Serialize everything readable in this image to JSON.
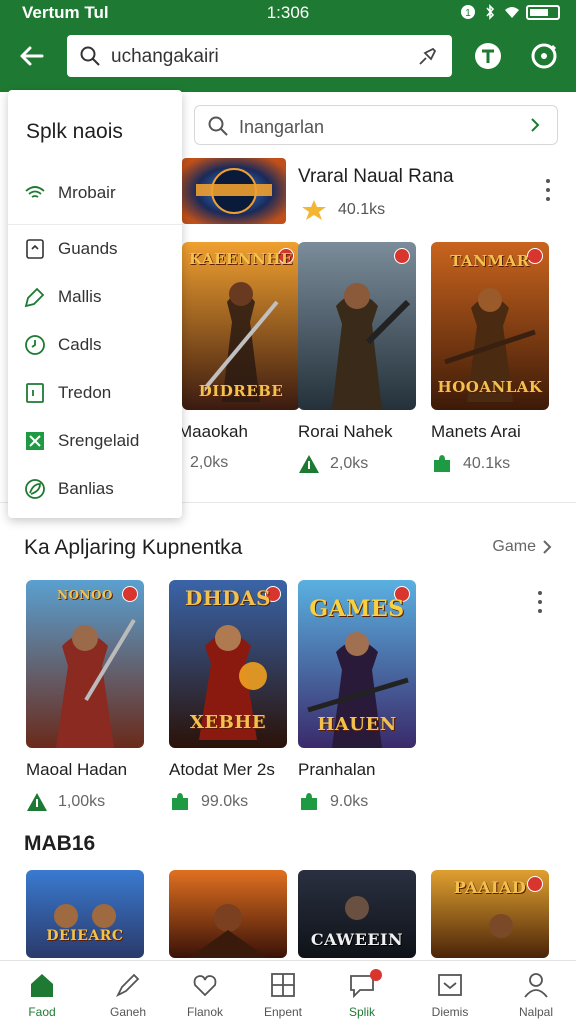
{
  "status_bar": {
    "carrier": "Vertum Tul",
    "time": "1:306"
  },
  "search_bar": {
    "query": "uchangakairi"
  },
  "secondary_search": {
    "placeholder": "Inangarlan"
  },
  "featured": {
    "title": "Vraral Naual Rana",
    "rating": "40.1ks"
  },
  "top_row": [
    {
      "title": "Maaokah",
      "meta": "2,0ks",
      "art_text": "KAEENNHE",
      "art_bottom": "DIDREBE",
      "colors": [
        "#f0a030",
        "#3a1a10"
      ]
    },
    {
      "title": "Rorai Nahek",
      "meta": "2,0ks",
      "art_text": "",
      "art_bottom": "",
      "colors": [
        "#7b8c9a",
        "#24313a"
      ]
    },
    {
      "title": "Manets Arai",
      "meta": "40.1ks",
      "art_text": "TANMAR",
      "art_bottom": "HOOANLAK",
      "colors": [
        "#c9641e",
        "#3c1a08"
      ]
    }
  ],
  "section_1": {
    "title": "Ka Apljaring Kupnentka",
    "link": "Game",
    "cards": [
      {
        "title": "Maoal Hadan",
        "meta": "1,00ks",
        "art_text": "NONOO",
        "art_bottom": "",
        "colors": [
          "#5aa0d0",
          "#6a2a1a"
        ]
      },
      {
        "title": "Atodat Mer 2s",
        "meta": "99.0ks",
        "art_text": "DHDAS",
        "art_bottom": "XEBHE",
        "colors": [
          "#3a64a8",
          "#2a1208"
        ]
      },
      {
        "title": "Pranhalan",
        "meta": "9.0ks",
        "art_text": "GAMES",
        "art_bottom": "HAUEN",
        "colors": [
          "#5ab0e0",
          "#3a2a6a"
        ]
      }
    ]
  },
  "section_2": {
    "title": "MAB16",
    "cards": [
      {
        "art_text": "",
        "art_bottom": "DEIEARC",
        "colors": [
          "#3a7ad0",
          "#2a3a6a"
        ]
      },
      {
        "art_text": "",
        "art_bottom": "",
        "colors": [
          "#e07020",
          "#3a1208"
        ]
      },
      {
        "art_text": "",
        "art_bottom": "CAWEEIN",
        "colors": [
          "#2a3040",
          "#0e1218"
        ]
      },
      {
        "art_text": "PAAIAD",
        "art_bottom": "",
        "colors": [
          "#e0a030",
          "#4a2408"
        ]
      }
    ]
  },
  "menu": {
    "title": "Splk naois",
    "items": [
      {
        "label": "Mrobair",
        "icon": "wifi-icon"
      },
      {
        "label": "Guands",
        "icon": "tablet-icon"
      },
      {
        "label": "Mallis",
        "icon": "tag-icon"
      },
      {
        "label": "Cadls",
        "icon": "clock-icon"
      },
      {
        "label": "Tredon",
        "icon": "book-icon"
      },
      {
        "label": "Srengelaid",
        "icon": "grid-icon"
      },
      {
        "label": "Banlias",
        "icon": "leaf-icon"
      }
    ]
  },
  "bottom_nav": [
    {
      "label": "Faod",
      "icon": "home-icon",
      "active": true
    },
    {
      "label": "Ganeh",
      "icon": "pen-icon",
      "active": false
    },
    {
      "label": "Flanok",
      "icon": "heart-icon",
      "active": false
    },
    {
      "label": "Enpent",
      "icon": "grid-icon",
      "active": false
    },
    {
      "label": "Splik",
      "icon": "chat-icon",
      "active": false
    },
    {
      "label": "Diemis",
      "icon": "inbox-icon",
      "active": false
    },
    {
      "label": "Nalpal",
      "icon": "person-icon",
      "active": false
    }
  ],
  "colors": {
    "brand_green": "#1e7a33",
    "badge_red": "#d9352f"
  }
}
